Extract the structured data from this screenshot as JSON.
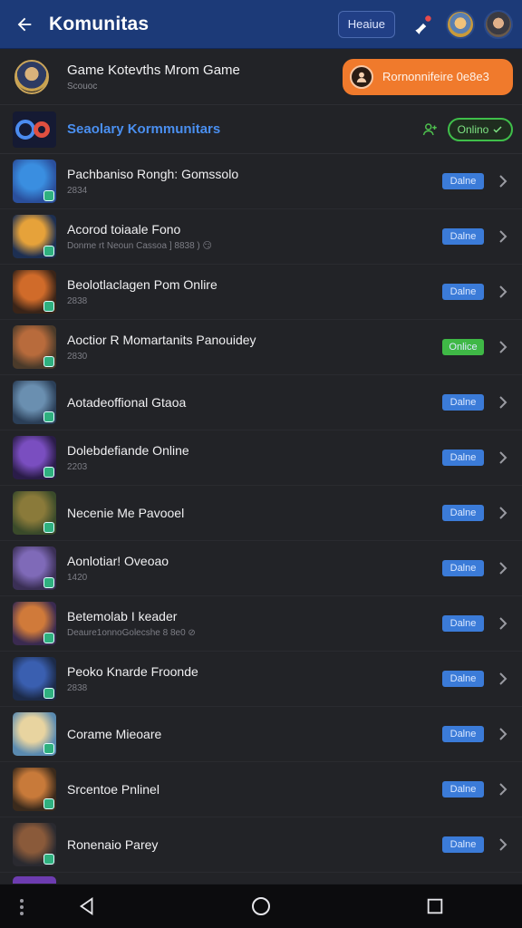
{
  "appbar": {
    "title": "Komunitas",
    "header_button": "Heaiue"
  },
  "header": {
    "title": "Game Kotevths Mrom Game",
    "subtitle": "Scouoc",
    "action_label": "Rornonnifeire 0e8e3"
  },
  "featured": {
    "label": "Seaolary Kormmunitars",
    "online_label": "Onlino"
  },
  "items": [
    {
      "name": "Pachbaniso Rongh: Gomssolo",
      "sub": "2834",
      "status": "Dalne",
      "status_color": "#3b7bd8",
      "thumb": [
        "#3a8ee0",
        "#2a4f9c"
      ]
    },
    {
      "name": "Acorod toiaale Fono",
      "sub": "Donme rt Neoun Cassoa ] 8838 ) 😏",
      "status": "Dalne",
      "status_color": "#3b7bd8",
      "thumb": [
        "#e6a23a",
        "#1d2f52"
      ]
    },
    {
      "name": "Beolotlaclagen Pom Onlire",
      "sub": "2838",
      "status": "Dalne",
      "status_color": "#3b7bd8",
      "thumb": [
        "#d06b2a",
        "#3a2418"
      ]
    },
    {
      "name": "Aoctior R Momartanits Panouidey",
      "sub": "2830",
      "status": "Onlice",
      "status_color": "#3fb846",
      "thumb": [
        "#b86b3c",
        "#4a3a2a"
      ]
    },
    {
      "name": "Aotadeoffional Gtaoa",
      "sub": "",
      "status": "Dalne",
      "status_color": "#3b7bd8",
      "thumb": [
        "#6a8fb0",
        "#2b3f58"
      ]
    },
    {
      "name": "Dolebdefiande Online",
      "sub": "2203",
      "status": "Dalne",
      "status_color": "#3b7bd8",
      "thumb": [
        "#7a4ec0",
        "#2a1c48"
      ]
    },
    {
      "name": "Necenie Me Pavooel",
      "sub": "",
      "status": "Dalne",
      "status_color": "#3b7bd8",
      "thumb": [
        "#8a7a3a",
        "#3a4a2a"
      ]
    },
    {
      "name": "Aonlotiar! Oveoao",
      "sub": "1420",
      "status": "Dalne",
      "status_color": "#3b7bd8",
      "thumb": [
        "#7f6ab8",
        "#3a2f55"
      ]
    },
    {
      "name": "Betemolab I keader",
      "sub": "Deaure1onnoGolecshe 8 8e0 ⊘",
      "status": "Dalne",
      "status_color": "#3b7bd8",
      "thumb": [
        "#d07a3a",
        "#3a2a50"
      ]
    },
    {
      "name": "Peoko Knarde Froonde",
      "sub": "2838",
      "status": "Dalne",
      "status_color": "#3b7bd8",
      "thumb": [
        "#3a5fb0",
        "#1c2a48"
      ]
    },
    {
      "name": "Corame Mieoare",
      "sub": "",
      "status": "Dalne",
      "status_color": "#3b7bd8",
      "thumb": [
        "#e8d4a0",
        "#5a8ab0"
      ]
    },
    {
      "name": "Srcentoe Pnlinel",
      "sub": "",
      "status": "Dalne",
      "status_color": "#3b7bd8",
      "thumb": [
        "#c87a3a",
        "#3a2a1c"
      ]
    },
    {
      "name": "Ronenaio Parey",
      "sub": "",
      "status": "Dalne",
      "status_color": "#3b7bd8",
      "thumb": [
        "#8a5a3a",
        "#2a2a30"
      ]
    }
  ]
}
